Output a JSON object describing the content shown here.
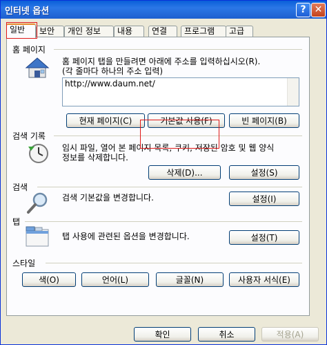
{
  "window": {
    "title": "인터넷 옵션"
  },
  "tabs": [
    {
      "label": "일반",
      "active": true
    },
    {
      "label": "보안"
    },
    {
      "label": "개인 정보"
    },
    {
      "label": "내용"
    },
    {
      "label": "연결"
    },
    {
      "label": "프로그램"
    },
    {
      "label": "고급"
    }
  ],
  "home": {
    "group_label": "홈 페이지",
    "desc1": "홈 페이지 탭을 만들려면 아래에 주소를 입력하십시오(R).",
    "desc2": "(각 줄마다 하나의 주소 입력)",
    "url": "http://www.daum.net/",
    "buttons": {
      "current": "현재 페이지(C)",
      "default": "기본값 사용(F)",
      "blank": "빈 페이지(B)"
    }
  },
  "history": {
    "group_label": "검색 기록",
    "desc1": "임시 파일, 열어 본 페이지 목록, 쿠키, 저장된 암호 및 웹 양식",
    "desc2": "정보를 삭제합니다.",
    "buttons": {
      "delete": "삭제(D)...",
      "settings": "설정(S)"
    }
  },
  "search": {
    "group_label": "검색",
    "desc": "검색 기본값을 변경합니다.",
    "buttons": {
      "settings": "설정(I)"
    }
  },
  "tabs_section": {
    "group_label": "탭",
    "desc": "탭 사용에 관련된 옵션을 변경합니다.",
    "buttons": {
      "settings": "설정(T)"
    }
  },
  "style": {
    "group_label": "스타일",
    "buttons": {
      "colors": "색(O)",
      "languages": "언어(L)",
      "fonts": "글꼴(N)",
      "accessibility": "사용자 서식(E)"
    }
  },
  "footer": {
    "ok": "확인",
    "cancel": "취소",
    "apply": "적용(A)"
  },
  "icons": {
    "home": "house-icon",
    "history": "clock-icon",
    "search": "magnifier-icon",
    "tabs": "tabs-icon",
    "help": "help-icon",
    "close": "close-icon"
  },
  "colors": {
    "title_bar": "#0a5fd8",
    "highlight": "#e01818",
    "face": "#ece9d8"
  }
}
